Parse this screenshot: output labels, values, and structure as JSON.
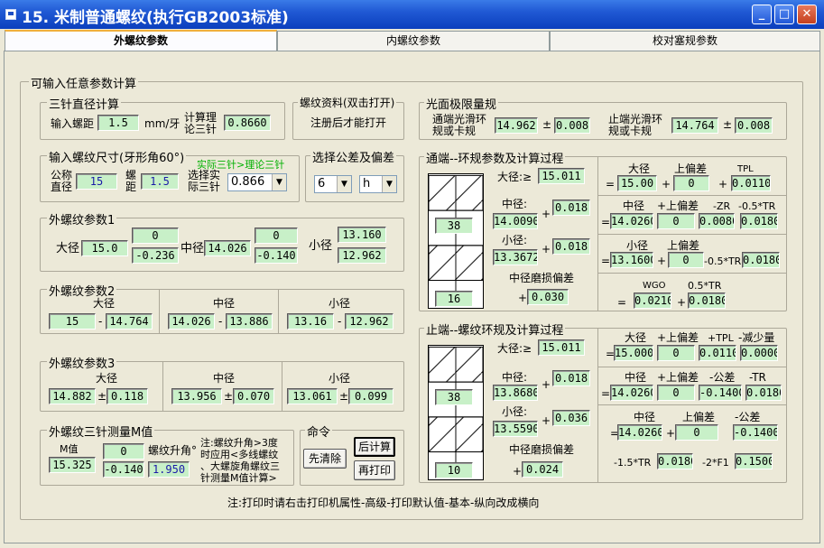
{
  "window": {
    "title": "15. 米制普通螺纹(执行GB2003标准)"
  },
  "tabs": [
    "外螺纹参数",
    "内螺纹参数",
    "校对塞规参数"
  ],
  "main_group": "可输入任意参数计算",
  "three_wire": {
    "title": "三针直径计算",
    "pitch_label": "输入螺距",
    "pitch": "1.5",
    "unit": "mm/牙",
    "theory_label_1": "计算理",
    "theory_label_2": "论三针",
    "theory": "0.8660"
  },
  "thread_info": {
    "title": "螺纹资料(双击打开)",
    "text": "注册后才能打开"
  },
  "size": {
    "title": "输入螺纹尺寸(牙形角60°)",
    "hint": "实际三针>理论三针",
    "nominal_1": "公称",
    "nominal_2": "直径",
    "nominal": "15",
    "pitch_1": "螺",
    "pitch_2": "距",
    "pitch": "1.5",
    "select_1": "选择实",
    "select_2": "际三针",
    "wire": "0.866"
  },
  "tolerance": {
    "title": "选择公差及偏差",
    "grade": "6",
    "position": "h"
  },
  "ext1": {
    "title": "外螺纹参数1",
    "major_label": "大径",
    "major": "15.0",
    "major_up": "0",
    "major_low": "-0.236",
    "pitch_label": "中径",
    "pitch": "14.026",
    "pitch_up": "0",
    "pitch_low": "-0.140",
    "minor_label": "小径",
    "minor_up": "13.160",
    "minor_low": "12.962"
  },
  "ext2": {
    "title": "外螺纹参数2",
    "major_label": "大径",
    "major_a": "15",
    "major_b": "14.764",
    "pitch_label": "中径",
    "pitch_a": "14.026",
    "pitch_b": "13.886",
    "minor_label": "小径",
    "minor_a": "13.16",
    "minor_b": "12.962",
    "dash": "-"
  },
  "ext3": {
    "title": "外螺纹参数3",
    "major_label": "大径",
    "major": "14.882",
    "major_tol": "0.118",
    "pitch_label": "中径",
    "pitch": "13.956",
    "pitch_tol": "0.070",
    "minor_label": "小径",
    "minor": "13.061",
    "minor_tol": "0.099",
    "pm": "±"
  },
  "mvalue": {
    "title": "外螺纹三针测量M值",
    "m_label": "M值",
    "m": "15.325",
    "m_up": "0",
    "m_low": "-0.140",
    "helix_label": "螺纹升角°",
    "helix": "1.950",
    "note": [
      "注:螺纹升角>3度",
      "时应用<多线螺纹",
      "、大螺旋角螺纹三",
      "针测量M值计算>"
    ]
  },
  "command": {
    "title": "命令",
    "clear": "先清除",
    "calc": "后计算",
    "print": "再打印"
  },
  "gauge": {
    "title": "光面极限量规",
    "go_1": "通端光滑环",
    "go_2": "规或卡规",
    "go": "14.962",
    "go_tol": "0.008",
    "nogo_1": "止端光滑环",
    "nogo_2": "规或卡规",
    "nogo": "14.764",
    "nogo_tol": "0.008",
    "pm": "±"
  },
  "go_ring": {
    "title": "通端--环规参数及计算过程",
    "box_top": "38",
    "box_bottom": "16",
    "major_label": "大径:≥",
    "major": "15.011",
    "pitch_label": "中径:",
    "pitch": "14.0090",
    "pitch_add": "0.018",
    "minor_label": "小径:",
    "minor": "13.3672",
    "minor_add": "0.018",
    "wear_label": "中径磨损偏差",
    "wear": "0.030",
    "r1": {
      "h1": "大径",
      "h2": "上偏差",
      "h3": "TPL",
      "v1": "15.00",
      "v2": "0",
      "v3": "0.0110"
    },
    "r2": {
      "h1": "中径",
      "h2": "+上偏差",
      "h3": "-ZR",
      "h4": "-0.5*TR",
      "v1": "14.0260",
      "v2": "0",
      "v3": "0.0080",
      "v4": "0.0180"
    },
    "r3": {
      "h1": "小径",
      "h2": "上偏差",
      "mid": "-0.5*TR",
      "v1": "13.1600",
      "v2": "0",
      "v3": "0.0180"
    },
    "r4": {
      "h1": "WGO",
      "h2": "0.5*TR",
      "v1": "0.0210",
      "v2": "0.0180"
    }
  },
  "nogo_ring": {
    "title": "止端--螺纹环规及计算过程",
    "box_top": "38",
    "box_bottom": "10",
    "major_label": "大径:≥",
    "major": "15.011",
    "pitch_label": "中径:",
    "pitch": "13.8680",
    "pitch_add": "0.018",
    "minor_label": "小径:",
    "minor": "13.5590",
    "minor_add": "0.036",
    "wear_label": "中径磨损偏差",
    "wear": "0.024",
    "r1": {
      "h1": "大径",
      "h2": "+上偏差",
      "h3": "+TPL",
      "h4": "-减少量",
      "v1": "15.000",
      "v2": "0",
      "v3": "0.0110",
      "v4": "0.0000"
    },
    "r2": {
      "h1": "中径",
      "h2": "+上偏差",
      "h3": "-公差",
      "h4": "-TR",
      "v1": "14.0260",
      "v2": "0",
      "v3": "-0.1400",
      "v4": "0.0180"
    },
    "r3": {
      "h1": "中径",
      "h2": "上偏差",
      "h3": "-公差",
      "v1": "14.0260",
      "v2": "0",
      "v3": "-0.1400",
      "l4": "-1.5*TR",
      "v4": "0.0180",
      "l5": "-2*F1",
      "v5": "0.1500"
    }
  },
  "footer": "注:打印时请右击打印机属性-高级-打印默认值-基本-纵向改成横向",
  "symbols": {
    "eq": "=",
    "plus": "+",
    "minus": "-"
  }
}
